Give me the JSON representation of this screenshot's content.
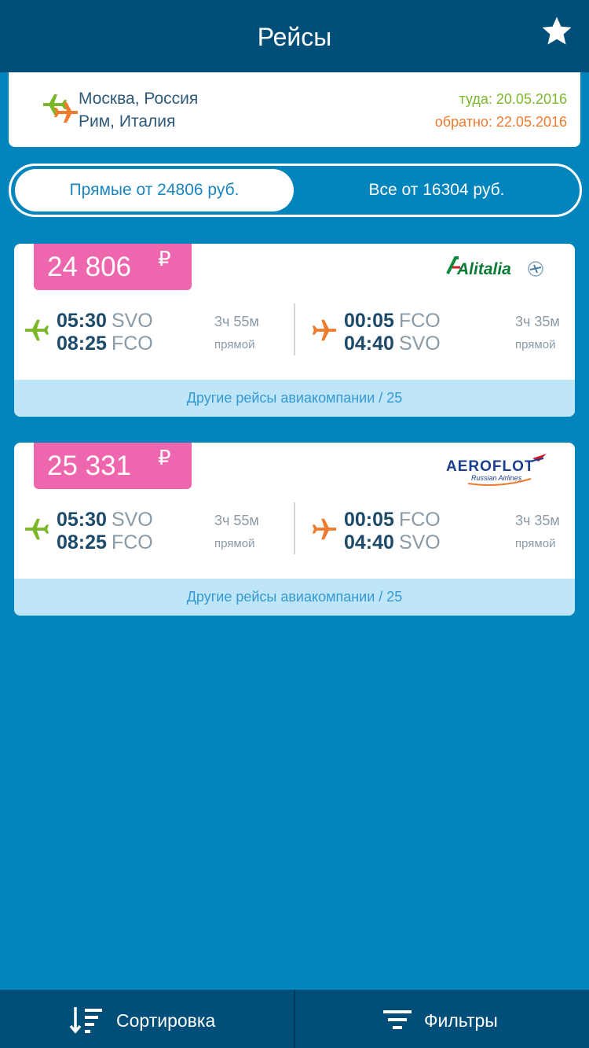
{
  "header": {
    "title": "Рейсы",
    "favorite_icon": "star-icon"
  },
  "route": {
    "from": "Москва, Россия",
    "to": "Рим, Италия",
    "departure": "туда: 20.05.2016",
    "return": "обратно: 22.05.2016"
  },
  "filter_tabs": {
    "direct": "Прямые от 24806 руб.",
    "all": "Все от 16304 руб."
  },
  "flights": [
    {
      "price": "24 806",
      "currency": "₽",
      "airline": "Alitalia",
      "outbound": {
        "dep_time": "05:30",
        "dep_code": "SVO",
        "arr_time": "08:25",
        "arr_code": "FCO",
        "duration": "3ч 55м",
        "type": "прямой"
      },
      "inbound": {
        "dep_time": "00:05",
        "dep_code": "FCO",
        "arr_time": "04:40",
        "arr_code": "SVO",
        "duration": "3ч 35м",
        "type": "прямой"
      },
      "other_flights": "Другие рейсы авиакомпании / 25"
    },
    {
      "price": "25 331",
      "currency": "₽",
      "airline": "AEROFLOT",
      "airline_sub": "Russian Airlines",
      "outbound": {
        "dep_time": "05:30",
        "dep_code": "SVO",
        "arr_time": "08:25",
        "arr_code": "FCO",
        "duration": "3ч 55м",
        "type": "прямой"
      },
      "inbound": {
        "dep_time": "00:05",
        "dep_code": "FCO",
        "arr_time": "04:40",
        "arr_code": "SVO",
        "duration": "3ч 35м",
        "type": "прямой"
      },
      "other_flights": "Другие рейсы авиакомпании / 25"
    }
  ],
  "bottom": {
    "sort": "Сортировка",
    "filters": "Фильтры"
  },
  "colors": {
    "background": "#0284bd",
    "bar": "#014f78",
    "price_badge": "#ee66ad",
    "outbound_green": "#7ab829",
    "return_orange": "#ef7b2e",
    "other_flights_bg": "#bfe5f8"
  }
}
